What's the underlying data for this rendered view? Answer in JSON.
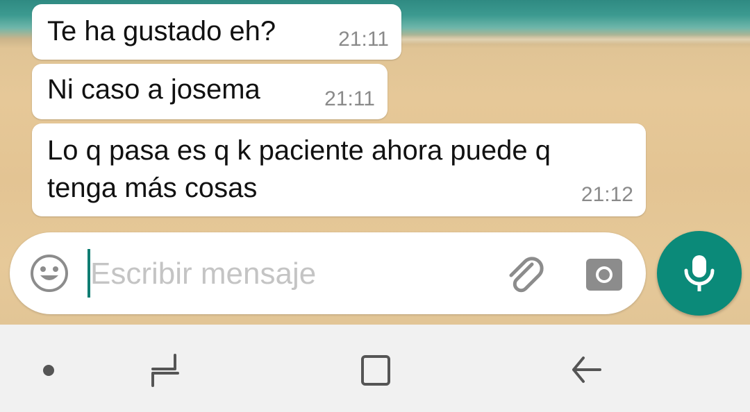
{
  "messages": [
    {
      "text": "Te ha gustado eh?",
      "time": "21:11"
    },
    {
      "text": "Ni caso a josema",
      "time": "21:11"
    },
    {
      "text": "Lo q pasa es q k paciente ahora puede q tenga más cosas",
      "time": "21:12"
    }
  ],
  "composer": {
    "placeholder": "Escribir mensaje",
    "value": ""
  },
  "colors": {
    "accent": "#0b8a79",
    "bubble": "#ffffff",
    "timestamp": "#8a8a8a",
    "navbar": "#f1f1f1"
  },
  "icons": {
    "emoji": "smiley-icon",
    "attach": "paperclip-icon",
    "camera": "camera-icon",
    "mic": "microphone-icon",
    "nav_dot": "nav-dot-icon",
    "nav_recent": "recent-apps-icon",
    "nav_home": "home-icon",
    "nav_back": "back-arrow-icon"
  }
}
